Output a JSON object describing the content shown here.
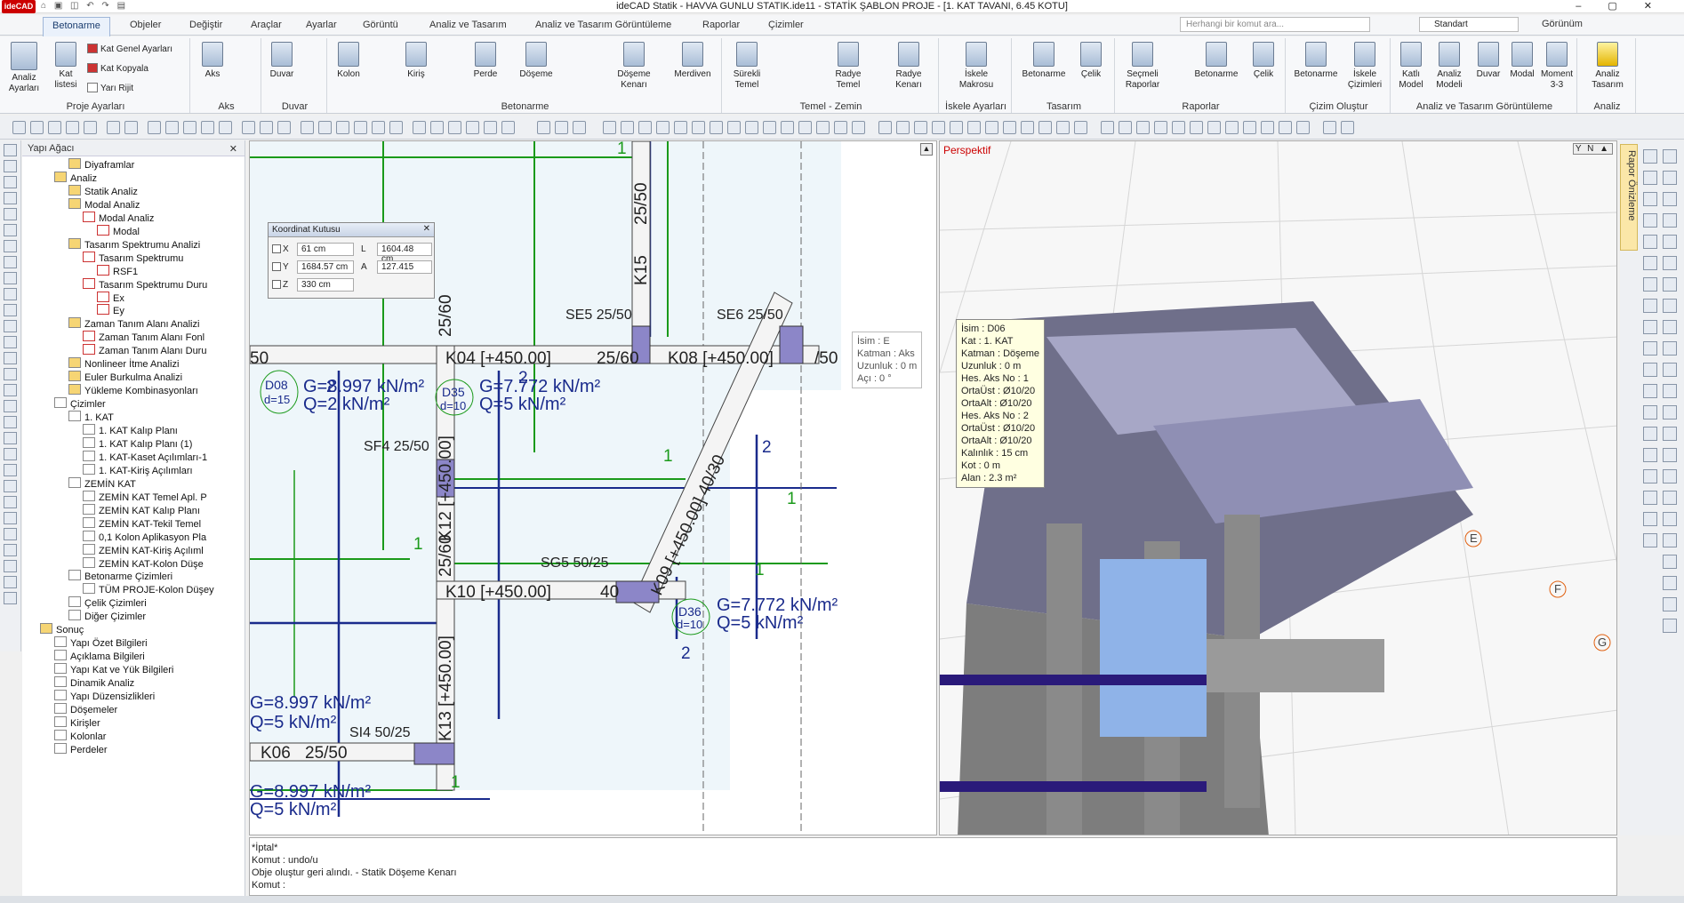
{
  "app": {
    "logo": "ideCAD",
    "title": "ideCAD Statik - HAVVA GUNLU STATIK.ide11 - STATİK ŞABLON PROJE - [1. KAT TAVANI,  6.45 KOTU]"
  },
  "tabs": [
    "Betonarme",
    "Objeler",
    "Değiştir",
    "Araçlar",
    "Ayarlar",
    "Görüntü",
    "Analiz ve Tasarım",
    "Analiz ve Tasarım Görüntüleme",
    "Raporlar",
    "Çizimler"
  ],
  "command_search": {
    "placeholder": "Herhangi bir komut ara..."
  },
  "style_select": "Standart",
  "view_menu": "Görünüm",
  "ribbon": {
    "proje": {
      "label": "Proje Ayarları",
      "analiz": "Analiz Ayarları",
      "kat": "Kat listesi",
      "kat_genel": "Kat Genel Ayarları",
      "kat_kopyala": "Kat Kopyala",
      "yari_rijit": "Yarı Rijit"
    },
    "aks": {
      "label": "Aks",
      "btn": "Aks"
    },
    "duvar": {
      "label": "Duvar",
      "btn": "Duvar"
    },
    "betonarme": {
      "label": "Betonarme",
      "kolon": "Kolon",
      "kiris": "Kiriş",
      "perde": "Perde",
      "doseme": "Döşeme",
      "doseme_kenari": "Döşeme Kenarı",
      "merdiven": "Merdiven"
    },
    "temel": {
      "label": "Temel - Zemin",
      "surekli": "Sürekli Temel",
      "radye": "Radye Temel",
      "radye_kenari": "Radye Kenarı"
    },
    "iskele": {
      "label": "İskele Ayarları",
      "btn": "İskele Makrosu"
    },
    "tasarim": {
      "label": "Tasarım",
      "betonarme": "Betonarme",
      "celik": "Çelik"
    },
    "raporlar": {
      "label": "Raporlar",
      "secmeli": "Seçmeli Raporlar",
      "betonarme": "Betonarme",
      "celik": "Çelik"
    },
    "cizim": {
      "label": "Çizim Oluştur",
      "betonarme": "Betonarme",
      "iskele": "İskele Çizimleri"
    },
    "atg": {
      "label": "Analiz ve Tasarım Görüntüleme",
      "katli": "Katlı Model",
      "analiz": "Analiz Modeli",
      "duvar": "Duvar",
      "modal": "Modal",
      "moment": "Moment 3-3"
    },
    "analiz": {
      "label": "Analiz",
      "btn": "Analiz Tasarım"
    }
  },
  "tree": {
    "title": "Yapı Ağacı",
    "nodes": [
      "Diyaframlar",
      "Analiz",
      "Statik Analiz",
      "Modal Analiz",
      "Modal Analiz",
      "Modal",
      "Tasarım Spektrumu Analizi",
      "Tasarım Spektrumu",
      "RSF1",
      "Tasarım Spektrumu Duru",
      "Ex",
      "Ey",
      "Zaman Tanım Alanı Analizi",
      "Zaman Tanım Alanı Fonl",
      "Zaman Tanım Alanı Duru",
      "Nonlineer İtme Analizi",
      "Euler Burkulma Analizi",
      "Yükleme Kombinasyonları",
      "Çizimler",
      "1. KAT",
      "1. KAT Kalıp Planı",
      "1. KAT Kalıp Planı (1)",
      "1. KAT-Kaset Açılımları-1",
      "1. KAT-Kiriş Açılımları",
      "ZEMİN KAT",
      "ZEMİN KAT Temel Apl. P",
      "ZEMİN KAT Kalıp Planı",
      "ZEMİN KAT-Tekil Temel",
      "0,1 Kolon Aplikasyon Pla",
      "ZEMİN KAT-Kiriş Açılıml",
      "ZEMİN KAT-Kolon Düşe",
      "Betonarme Çizimleri",
      "TÜM PROJE-Kolon Düşey",
      "Çelik Çizimleri",
      "Diğer Çizimler",
      "Sonuç",
      "Yapı Özet Bilgileri",
      "Açıklama Bilgileri",
      "Yapı Kat ve Yük Bilgileri",
      "Dinamik Analiz",
      "Yapı Düzensizlikleri",
      "Döşemeler",
      "Kirişler",
      "Kolonlar",
      "Perdeler"
    ]
  },
  "coord": {
    "title": "Koordinat Kutusu",
    "x_label": "X",
    "x": "61 cm",
    "y_label": "Y",
    "y": "1684.57 cm",
    "z_label": "Z",
    "z": "330 cm",
    "l_label": "L",
    "l": "1604.48 cm",
    "a_label": "A",
    "a": "127.415"
  },
  "plan": {
    "labels": [
      "K04 [+450.00]",
      "25/60",
      "K08 [+450.00]",
      "/50",
      "50",
      "K10 [+450.00]",
      "40",
      "K06",
      "25/50",
      "SE5 25/50",
      "SE6 25/50",
      "SF4 25/50",
      "SG5 50/25",
      "SI4 50/25",
      "K15",
      "25/50",
      "K12 [+450.00]",
      "25/60",
      "K13 [+450.00]",
      "25/60",
      "K09 [+450.00]  40/30",
      "1",
      "1",
      "1",
      "1",
      "1",
      "1",
      "2",
      "2",
      "2",
      "2"
    ],
    "slabs": [
      {
        "id": "D08",
        "d": "d=15",
        "g": "G=8.997 kN/m²",
        "q": "Q=2 kN/m²"
      },
      {
        "id": "D35",
        "d": "d=10",
        "g": "G=7.772 kN/m²",
        "q": "Q=5 kN/m²"
      },
      {
        "id": "D36",
        "d": "d=10",
        "g": "G=7.772 kN/m²",
        "q": "Q=5 kN/m²"
      }
    ],
    "loads": [
      {
        "g": "G=8.997 kN/m²",
        "q": "Q=5 kN/m²"
      },
      {
        "g": "G=8.997 kN/m²",
        "q": "Q=5 kN/m²"
      }
    ],
    "tooltip": [
      "İsim : E",
      "Katman : Aks",
      "Uzunluk : 0 m",
      "Açı : 0 °"
    ]
  },
  "persp": {
    "label": "Perspektif",
    "axes": [
      "E",
      "F",
      "G"
    ],
    "tooltip": [
      "İsim : D06",
      "Kat : 1. KAT",
      "Katman : Döşeme",
      "Uzunluk : 0 m",
      "Hes. Aks No : 1",
      "OrtaÜst : Ø10/20",
      "OrtaAlt : Ø10/20",
      "Hes. Aks No : 2",
      "OrtaÜst : Ø10/20",
      "OrtaAlt : Ø10/20",
      "Kalınlık : 15 cm",
      "Kot : 0 m",
      "Alan : 2.3 m²"
    ]
  },
  "rapor_tab": "Rapor Önizleme",
  "cmdline": [
    "*İptal*",
    "Komut : undo/u",
    "Obje oluştur geri alındı. - Statik Döşeme Kenarı",
    "Komut :"
  ]
}
